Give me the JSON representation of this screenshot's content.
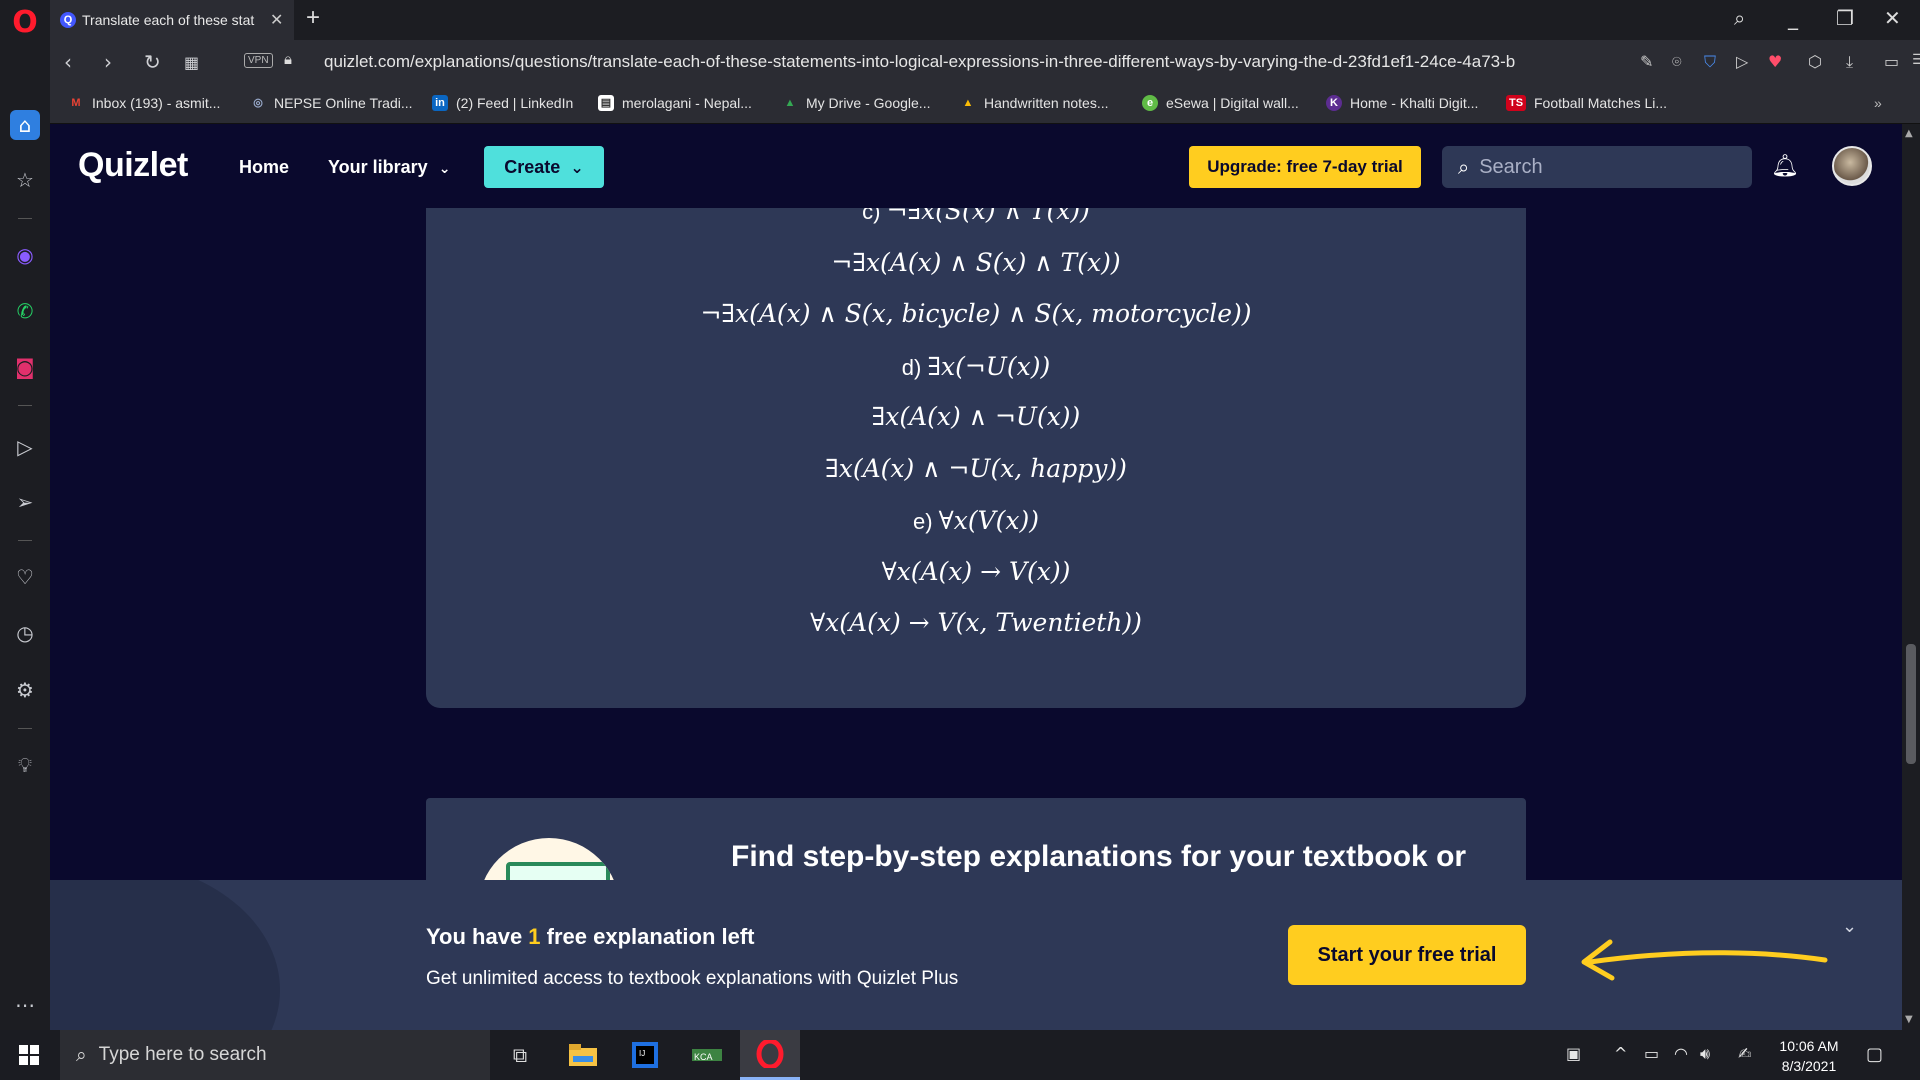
{
  "browser": {
    "tab_title": "Translate each of these stat",
    "tab_favicon": "Q",
    "url": "quizlet.com/explanations/questions/translate-each-of-these-statements-into-logical-expressions-in-three-different-ways-by-varying-the-d-23fd1ef1-24ce-4a73-b",
    "vpn_label": "VPN",
    "bookmarks": [
      {
        "label": "Inbox (193) - asmit...",
        "icon": "gmail-icon",
        "icon_text": "M",
        "color": "#ea4335"
      },
      {
        "label": "NEPSE Online Tradi...",
        "icon": "globe-icon",
        "icon_text": "◎",
        "color": "#8899aa"
      },
      {
        "label": "(2) Feed | LinkedIn",
        "icon": "linkedin-icon",
        "icon_text": "in",
        "color": "#0a66c2"
      },
      {
        "label": "merolagani - Nepal...",
        "icon": "page-icon",
        "icon_text": "▤",
        "color": "#ffffff"
      },
      {
        "label": "My Drive - Google...",
        "icon": "google-drive-icon",
        "icon_text": "▲",
        "color": "#34a853"
      },
      {
        "label": "Handwritten notes...",
        "icon": "google-drive-icon",
        "icon_text": "▲",
        "color": "#fbbc05"
      },
      {
        "label": "eSewa | Digital wall...",
        "icon": "esewa-icon",
        "icon_text": "e",
        "color": "#60bb46"
      },
      {
        "label": "Home - Khalti Digit...",
        "icon": "khalti-icon",
        "icon_text": "K",
        "color": "#5c2d91"
      },
      {
        "label": "Football Matches Li...",
        "icon": "ts-icon",
        "icon_text": "TS",
        "color": "#d0021b"
      }
    ]
  },
  "header": {
    "logo": "Quizlet",
    "nav_home": "Home",
    "nav_library": "Your library",
    "create_label": "Create",
    "upgrade_label": "Upgrade: free 7-day trial",
    "search_placeholder": "Search"
  },
  "explanation": {
    "lines": [
      {
        "label": "c) ",
        "expr": "¬∃x(S(x) ∧ T(x))"
      },
      {
        "label": "",
        "expr": "¬∃x(A(x) ∧ S(x) ∧ T(x))"
      },
      {
        "label": "",
        "expr": "¬∃x(A(x) ∧ S(x, bicycle) ∧ S(x, motorcycle))"
      },
      {
        "label": "d) ",
        "expr": "∃x(¬U(x))"
      },
      {
        "label": "",
        "expr": "∃x(A(x) ∧ ¬U(x))"
      },
      {
        "label": "",
        "expr": "∃x(A(x) ∧ ¬U(x, happy))"
      },
      {
        "label": "e) ",
        "expr": "∀x(V(x))"
      },
      {
        "label": "",
        "expr": "∀x(A(x) → V(x))"
      },
      {
        "label": "",
        "expr": "∀x(A(x) → V(x, Twentieth))"
      }
    ]
  },
  "promo": {
    "find_title": "Find step-by-step explanations for your textbook or"
  },
  "banner": {
    "title_prefix": "You have ",
    "title_count": "1",
    "title_suffix": " free explanation left",
    "subtitle": "Get unlimited access to textbook explanations with Quizlet Plus",
    "trial_button": "Start your free trial"
  },
  "taskbar": {
    "search_placeholder": "Type here to search",
    "time": "10:06 AM",
    "date": "8/3/2021"
  },
  "colors": {
    "quizlet_bg": "#0a092d",
    "card_bg": "#2e3856",
    "accent_yellow": "#ffcd1f",
    "accent_teal": "#4fe0dc"
  }
}
